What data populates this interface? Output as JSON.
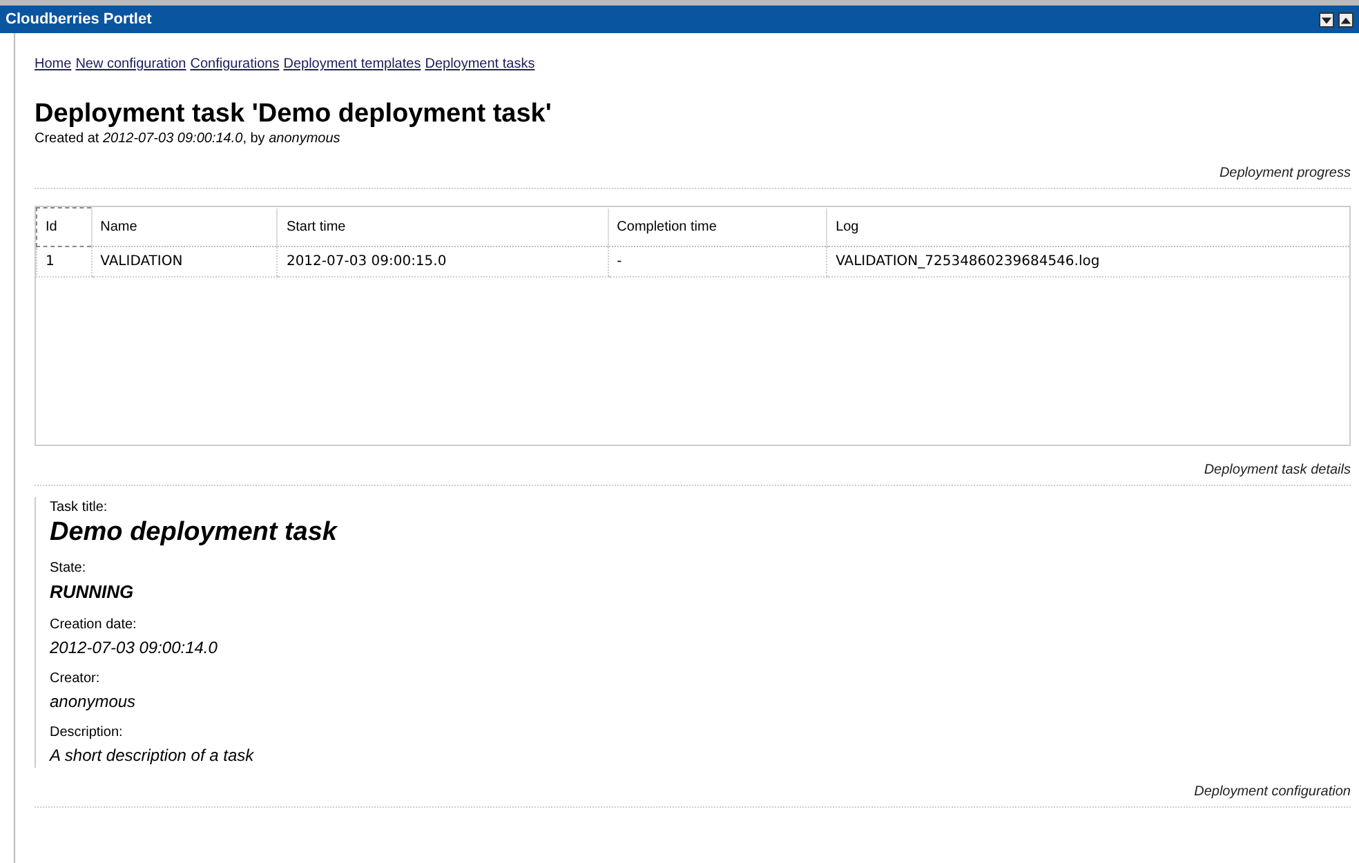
{
  "window": {
    "title": "Cloudberries Portlet"
  },
  "nav_links": [
    "Home",
    "New configuration",
    "Configurations",
    "Deployment templates",
    "Deployment tasks"
  ],
  "heading": "Deployment task 'Demo deployment task'",
  "subtitle": "Created at *2012-07-03 09:00:14.0*, by *anonymous*",
  "sections": [
    {
      "title": "Deployment progress",
      "kind": "table"
    },
    {
      "title": "Deployment task details",
      "kind": "details"
    },
    {
      "title": "Deployment configuration",
      "kind": "empty"
    }
  ],
  "table": {
    "columns": [
      "Id",
      "Name",
      "Start time",
      "Completion time",
      "Log"
    ],
    "rows": [
      [
        "1",
        "VALIDATION",
        "2012-07-03 09:00:15.0",
        "-",
        "VALIDATION_72534860239684546.log"
      ]
    ]
  },
  "details": [
    {
      "label": "Task title:",
      "value": "Demo deployment task",
      "kind": "title"
    },
    {
      "label": "State:",
      "value": "RUNNING",
      "kind": "state"
    },
    {
      "label": "Creation date:",
      "value": "2012-07-03 09:00:14.0",
      "kind": "plain"
    },
    {
      "label": "Creator:",
      "value": "anonymous",
      "kind": "plain"
    },
    {
      "label": "Description:",
      "value": "A short description of a task",
      "kind": "plain"
    }
  ]
}
